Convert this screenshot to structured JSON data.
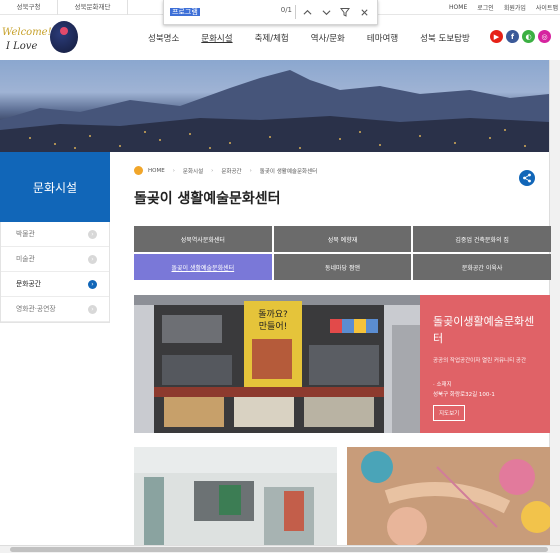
{
  "top": {
    "site_tabs": [
      "성북구청",
      "성북문화재단"
    ],
    "links": [
      "HOME",
      "로그인",
      "회원가입",
      "사이트맵"
    ]
  },
  "findbar": {
    "query": "프로그램",
    "count": "0/1"
  },
  "header": {
    "logo_text_1": "Welcome!",
    "logo_text_2": "I Love",
    "logo_seal_text": "성북",
    "menu": [
      "성북명소",
      "문화시설",
      "축제/체험",
      "역사/문화",
      "테마여행",
      "성북 도보탐방"
    ],
    "active_menu": "문화시설",
    "sns": [
      {
        "name": "youtube",
        "color": "#e62117",
        "glyph": "▶"
      },
      {
        "name": "facebook",
        "color": "#3b5998",
        "glyph": "f"
      },
      {
        "name": "kakao",
        "color": "#3cb043",
        "glyph": "◐"
      },
      {
        "name": "instagram",
        "color": "#d6249f",
        "glyph": "◎"
      }
    ]
  },
  "sidebar": {
    "title": "문화시설",
    "items": [
      {
        "label": "박물관",
        "active": false
      },
      {
        "label": "미술관",
        "active": false
      },
      {
        "label": "문화공간",
        "active": true
      },
      {
        "label": "영화관·공연장",
        "active": false
      }
    ]
  },
  "breadcrumb": [
    "HOME",
    "문화시설",
    "문화공간",
    "돌곶이 생활예술문화센터"
  ],
  "page_title": "돌곶이 생활예술문화센터",
  "tabs": [
    {
      "label": "성북역사문화센터",
      "active": false
    },
    {
      "label": "성북 예향재",
      "active": false
    },
    {
      "label": "김중업 건축문화의 집",
      "active": false
    },
    {
      "label": "돌곶이 생활예술문화센터",
      "active": true
    },
    {
      "label": "동네마당 짬앤",
      "active": false
    },
    {
      "label": "문화공간 이육사",
      "active": false
    }
  ],
  "feature": {
    "name": "돌곶이생활예술문화센터",
    "desc": "공공의 작업공간이자 열린 커뮤니티 공간",
    "addr_label": "· 소재지",
    "addr": "성북구 화랑로32길 100-1",
    "map_button": "지도보기",
    "sign_text": "돌까요? 만들어!"
  },
  "colors": {
    "primary_blue": "#1166b8",
    "active_tab": "#7a78d8",
    "tab_bg": "#6b6b6b",
    "feature_red": "#e06267"
  }
}
